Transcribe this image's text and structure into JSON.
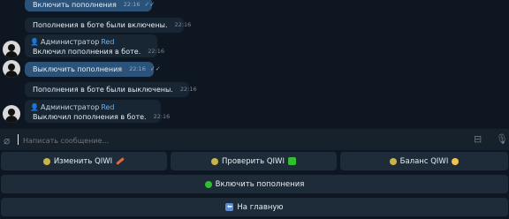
{
  "messages": [
    {
      "text": "Включить пополнения",
      "time": "22:16",
      "ticks": "✓✓",
      "dot": "green"
    },
    {
      "text": "Пополнения в боте были включены.",
      "time": "22:16",
      "dot": "green"
    },
    {
      "admin_label": "Администратор",
      "admin_name": "Red",
      "text": "Включил пополнения в боте.",
      "time": "22:16",
      "dot": "green"
    },
    {
      "text": "Выключить пополнения",
      "time": "22:16",
      "ticks": "✓✓",
      "dot": "red"
    },
    {
      "text": "Пополнения в боте были выключены.",
      "time": "22:16",
      "dot": "red"
    },
    {
      "admin_label": "Администратор",
      "admin_name": "Red",
      "text": "Выключил пополнения в боте.",
      "time": "22:16",
      "dot": "red"
    }
  ],
  "input": {
    "placeholder": "Написать сообщение..."
  },
  "keyboard": {
    "row1": [
      "Изменить QIWI",
      "Проверить QIWI",
      "Баланс QIWI"
    ],
    "row2": "Включить пополнения",
    "row3": "На главную"
  },
  "colors": {
    "background": "#0e1621",
    "incoming": "#182533",
    "outgoing": "#2b5278",
    "button": "#1e2c3a",
    "green": "#2fbf2f",
    "red": "#e23b3b"
  }
}
